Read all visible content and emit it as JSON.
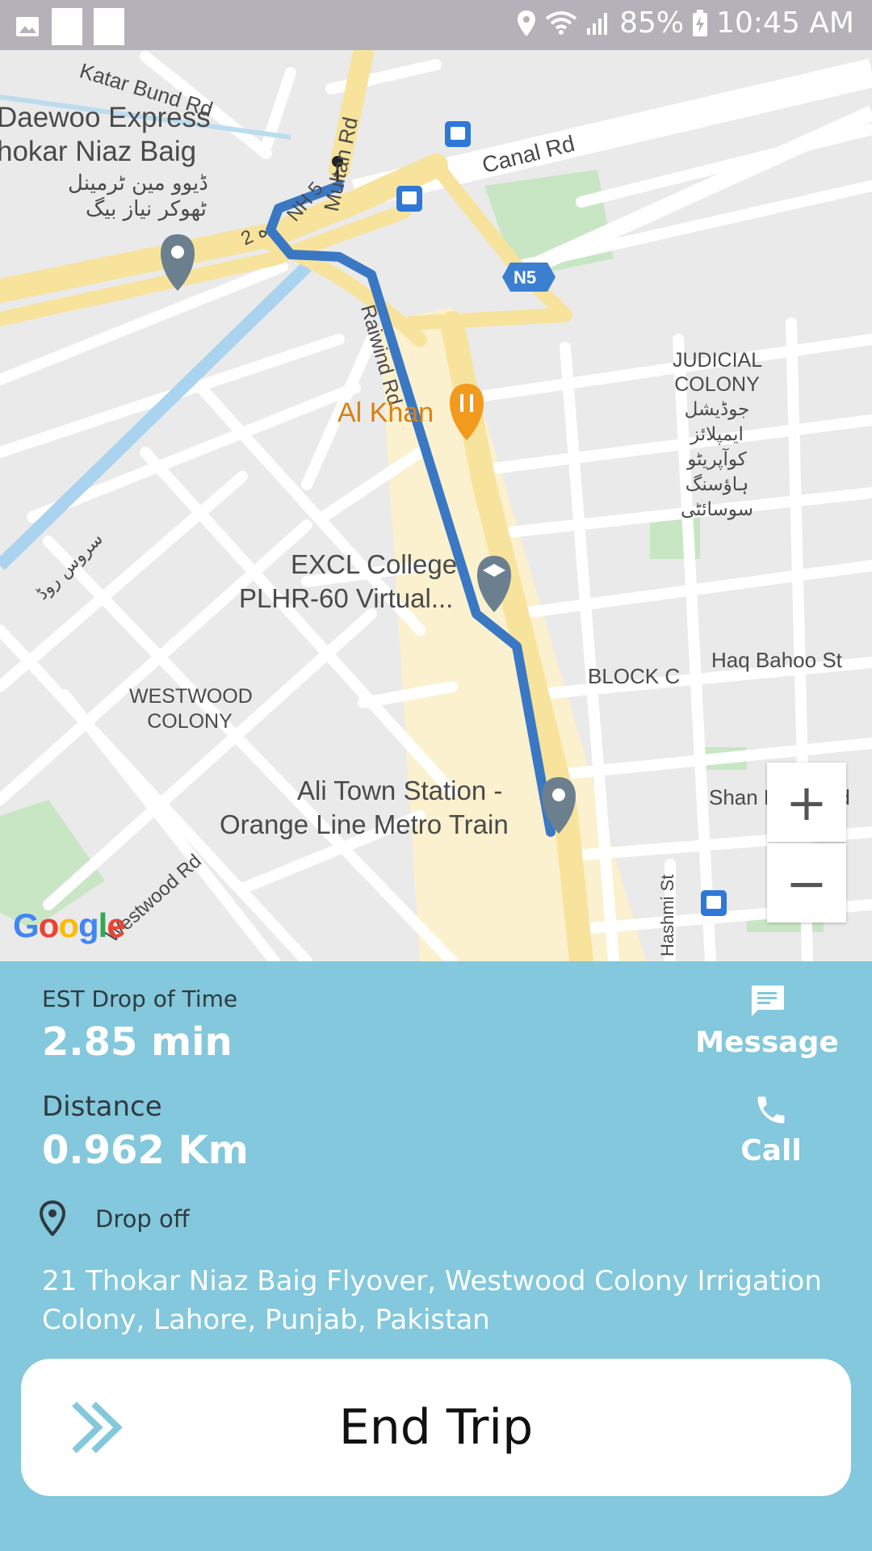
{
  "status_bar": {
    "battery": "85%",
    "time": "10:45 AM",
    "icons": [
      "image-icon",
      "location-icon",
      "wifi-icon",
      "signal-icon",
      "battery-charging-icon"
    ]
  },
  "map": {
    "labels": {
      "katar_bund_rd": "Katar Bund Rd",
      "daewoo_1": "Daewoo Express",
      "daewoo_2": "hokar Niaz Baig",
      "daewoo_urdu_1": "ڈیوو مین ٹرمینل",
      "daewoo_urdu_2": "ٹھوکر نیاز بیگ",
      "multan_rd": "Multan Rd",
      "nh5": "NH 5",
      "road_2": "2 ه",
      "canal_rd": "Canal Rd",
      "n5_badge": "N5",
      "raiwind_rd": "Raiwind Rd",
      "al_khan": "Al Khan",
      "judicial_1": "JUDICIAL",
      "judicial_2": "COLONY",
      "judicial_urdu": [
        "جوڈیشل",
        "ایمپلائز",
        "کوآپریٹو",
        "ہاؤسنگ",
        "سوسائٹی"
      ],
      "serus_road": "سروس روڈ",
      "excl_1": "EXCL College",
      "excl_2": "PLHR-60 Virtual...",
      "haq_bahoo": "Haq Bahoo St",
      "block_c": "BLOCK C",
      "westwood_1": "WESTWOOD",
      "westwood_2": "COLONY",
      "ali_town_1": "Ali Town Station -",
      "ali_town_2": "Orange Line Metro Train",
      "shan_bhatti": "Shan Bhatti Rd",
      "westwood_rd": "Westwood Rd",
      "hashmi_st": "Hashmi St",
      "google": "Google"
    },
    "zoom_in": "+",
    "zoom_out": "−",
    "colors": {
      "route": "#3b78c4",
      "major_road": "#f7e39b",
      "park": "#c8e6c4",
      "water": "#a9d3ef",
      "pin": "#6b7f8f",
      "food": "#f29a1e"
    }
  },
  "trip": {
    "eta_label": "EST Drop of Time",
    "eta_value": "2.85 min",
    "distance_label": "Distance",
    "distance_value": "0.962 Km",
    "dropoff_label": "Drop off",
    "address": "21 Thokar Niaz Baig Flyover, Westwood Colony Irrigation Colony, Lahore, Punjab, Pakistan",
    "message_label": "Message",
    "call_label": "Call",
    "end_trip_label": "End Trip",
    "accent_color": "#83c8dc"
  }
}
